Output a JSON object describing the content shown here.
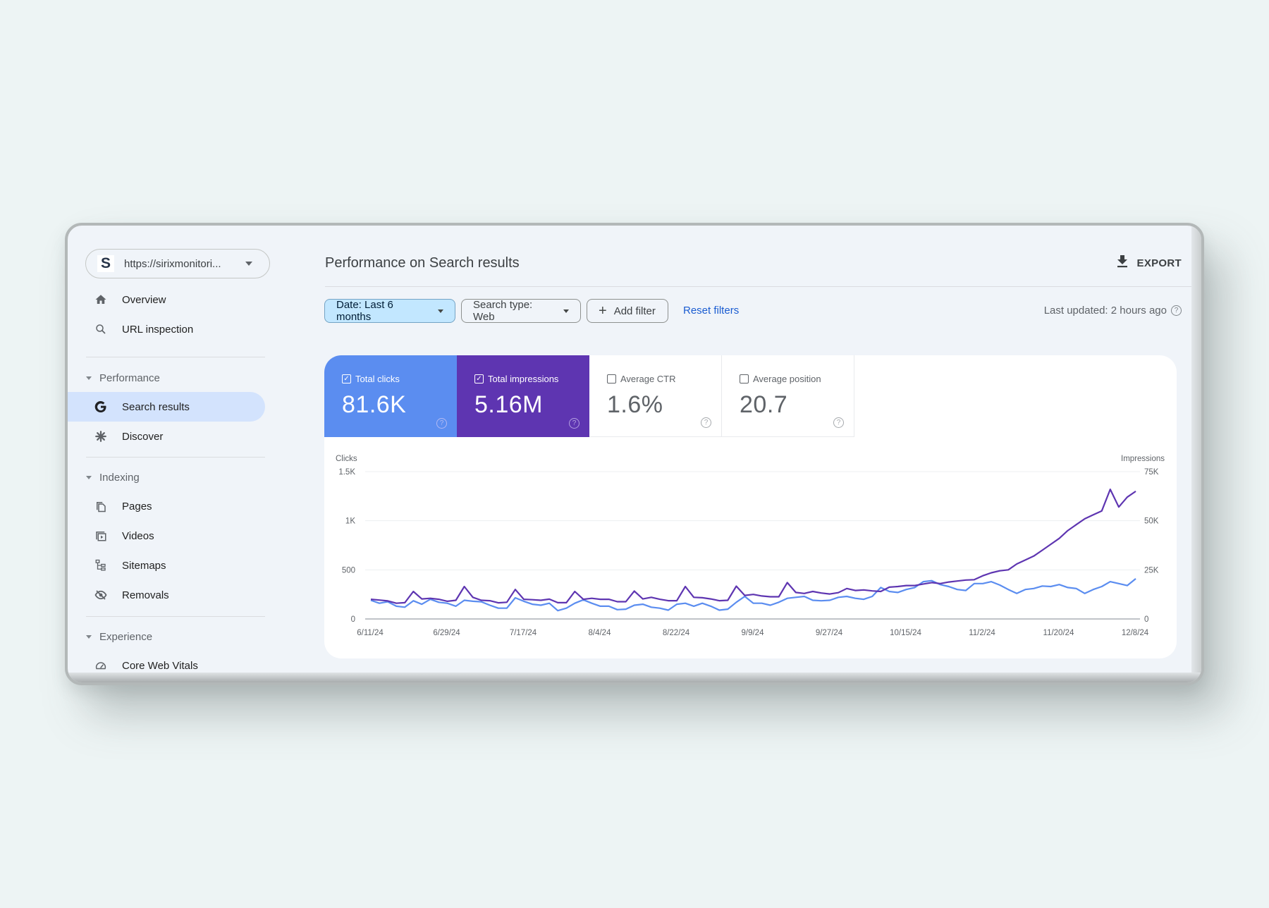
{
  "site": {
    "logo_letter": "S",
    "url": "https://sirixmonitori..."
  },
  "sidebar": {
    "top_items": [
      {
        "label": "Overview",
        "icon": "home-icon"
      },
      {
        "label": "URL inspection",
        "icon": "search-icon"
      }
    ],
    "sections": [
      {
        "label": "Performance",
        "items": [
          {
            "label": "Search results",
            "icon": "google-g-icon",
            "active": true
          },
          {
            "label": "Discover",
            "icon": "asterisk-icon"
          }
        ]
      },
      {
        "label": "Indexing",
        "items": [
          {
            "label": "Pages",
            "icon": "pages-icon"
          },
          {
            "label": "Videos",
            "icon": "video-icon"
          },
          {
            "label": "Sitemaps",
            "icon": "sitemap-icon"
          },
          {
            "label": "Removals",
            "icon": "eye-off-icon"
          }
        ]
      },
      {
        "label": "Experience",
        "items": [
          {
            "label": "Core Web Vitals",
            "icon": "gauge-icon"
          }
        ]
      }
    ]
  },
  "header": {
    "title": "Performance on Search results",
    "export_label": "EXPORT"
  },
  "filters": {
    "date": "Date: Last 6 months",
    "search_type": "Search type: Web",
    "add_filter": "Add filter",
    "reset": "Reset filters",
    "last_updated": "Last updated: 2 hours ago"
  },
  "metrics": [
    {
      "label": "Total clicks",
      "value": "81.6K",
      "checked": true,
      "color": "#5b8df0"
    },
    {
      "label": "Total impressions",
      "value": "5.16M",
      "checked": true,
      "color": "#5e35b1"
    },
    {
      "label": "Average CTR",
      "value": "1.6%",
      "checked": false
    },
    {
      "label": "Average position",
      "value": "20.7",
      "checked": false
    }
  ],
  "chart_data": {
    "type": "line",
    "title": "",
    "xlabel": "",
    "ylabel_left": "Clicks",
    "ylabel_right": "Impressions",
    "ylim_left": [
      0,
      1500
    ],
    "ylim_right": [
      0,
      75000
    ],
    "yticks_left": [
      "0",
      "500",
      "1K",
      "1.5K"
    ],
    "yticks_right": [
      "0",
      "25K",
      "50K",
      "75K"
    ],
    "xtick_labels": [
      "6/11/24",
      "6/29/24",
      "7/17/24",
      "8/4/24",
      "8/22/24",
      "9/9/24",
      "9/27/24",
      "10/15/24",
      "11/2/24",
      "11/20/24",
      "12/8/24"
    ],
    "x_start": "6/11/24",
    "x_step_days": 2,
    "grid": true,
    "legend": "none",
    "series": [
      {
        "name": "Clicks",
        "axis": "left",
        "color": "#5b8df0",
        "values": [
          190,
          160,
          175,
          130,
          120,
          185,
          150,
          200,
          170,
          160,
          130,
          190,
          180,
          175,
          140,
          110,
          110,
          215,
          180,
          150,
          140,
          160,
          85,
          110,
          160,
          195,
          160,
          130,
          130,
          95,
          100,
          140,
          150,
          120,
          110,
          90,
          150,
          160,
          130,
          160,
          130,
          90,
          100,
          170,
          230,
          160,
          160,
          140,
          170,
          210,
          220,
          230,
          190,
          185,
          190,
          220,
          230,
          210,
          200,
          230,
          320,
          280,
          270,
          300,
          320,
          380,
          390,
          350,
          330,
          300,
          290,
          360,
          360,
          380,
          345,
          300,
          260,
          300,
          310,
          335,
          330,
          350,
          320,
          310,
          260,
          300,
          330,
          380,
          360,
          340,
          410
        ]
      },
      {
        "name": "Impressions",
        "axis": "right",
        "color": "#5e35b1",
        "values": [
          10000,
          9600,
          9200,
          8000,
          8300,
          14000,
          10200,
          10500,
          10000,
          9000,
          9500,
          16500,
          11000,
          9500,
          9300,
          8200,
          8500,
          15000,
          10000,
          9800,
          9500,
          10100,
          8300,
          8300,
          14000,
          10000,
          10500,
          10000,
          10000,
          8800,
          8800,
          14200,
          10200,
          11000,
          10000,
          9300,
          9300,
          16500,
          11000,
          10800,
          10200,
          9300,
          9500,
          16700,
          12000,
          12500,
          11700,
          11300,
          11300,
          18500,
          13500,
          13000,
          14000,
          13200,
          12700,
          13400,
          15500,
          14500,
          14800,
          14300,
          14000,
          16200,
          16500,
          17000,
          17000,
          17800,
          18500,
          18000,
          18800,
          19300,
          19800,
          20000,
          22000,
          23500,
          24500,
          25000,
          28000,
          30000,
          32000,
          35000,
          38000,
          41000,
          45000,
          48000,
          51000,
          53000,
          55000,
          66000,
          57000,
          62000,
          65000
        ]
      }
    ]
  }
}
